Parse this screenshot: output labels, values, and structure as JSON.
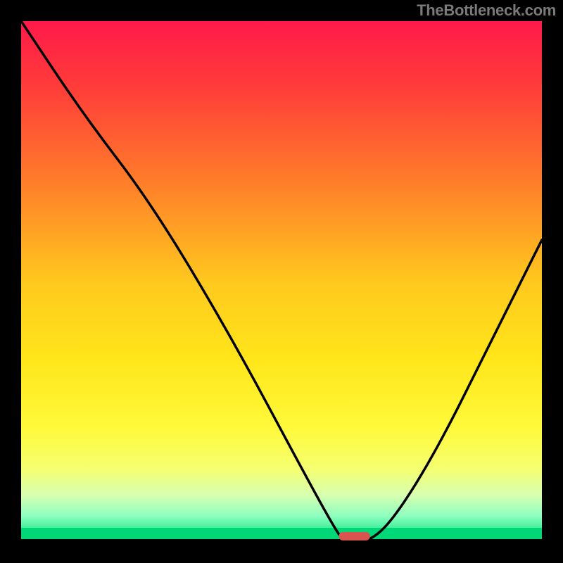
{
  "watermark": "TheBottleneck.com",
  "chart_data": {
    "type": "line",
    "title": "",
    "xlabel": "",
    "ylabel": "",
    "xlim": [
      0,
      100
    ],
    "ylim": [
      0,
      100
    ],
    "optimum_marker": {
      "x": 64,
      "width": 6,
      "color": "#d9534f"
    },
    "series": [
      {
        "name": "bottleneck-curve",
        "x": [
          0,
          12,
          25,
          40,
          55,
          60,
          62,
          67,
          72,
          80,
          90,
          100
        ],
        "values": [
          100,
          82,
          65,
          40,
          12,
          3,
          0,
          0,
          5,
          18,
          38,
          58
        ]
      }
    ],
    "background_gradient": {
      "stops": [
        {
          "offset": 0.0,
          "color": "#ff1a4a"
        },
        {
          "offset": 0.12,
          "color": "#ff3a3a"
        },
        {
          "offset": 0.3,
          "color": "#ff7a2a"
        },
        {
          "offset": 0.5,
          "color": "#ffc81e"
        },
        {
          "offset": 0.65,
          "color": "#ffe61a"
        },
        {
          "offset": 0.78,
          "color": "#fff93a"
        },
        {
          "offset": 0.86,
          "color": "#f5ff70"
        },
        {
          "offset": 0.91,
          "color": "#d8ffb0"
        },
        {
          "offset": 0.95,
          "color": "#8effc0"
        },
        {
          "offset": 0.985,
          "color": "#20e88a"
        },
        {
          "offset": 1.0,
          "color": "#00d878"
        }
      ]
    }
  }
}
